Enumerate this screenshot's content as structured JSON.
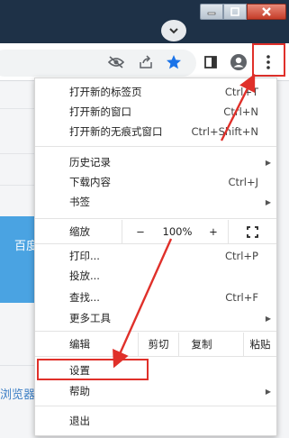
{
  "menu": {
    "new_tab": {
      "label": "打开新的标签页",
      "shortcut": "Ctrl+T"
    },
    "new_window": {
      "label": "打开新的窗口",
      "shortcut": "Ctrl+N"
    },
    "incognito": {
      "label": "打开新的无痕式窗口",
      "shortcut": "Ctrl+Shift+N"
    },
    "history": {
      "label": "历史记录"
    },
    "downloads": {
      "label": "下载内容",
      "shortcut": "Ctrl+J"
    },
    "bookmarks": {
      "label": "书签"
    },
    "zoom": {
      "label": "缩放",
      "minus": "−",
      "value": "100%",
      "plus": "+"
    },
    "print": {
      "label": "打印...",
      "shortcut": "Ctrl+P"
    },
    "cast": {
      "label": "投放..."
    },
    "find": {
      "label": "查找...",
      "shortcut": "Ctrl+F"
    },
    "more_tools": {
      "label": "更多工具"
    },
    "edit": {
      "label": "编辑",
      "cut": "剪切",
      "copy": "复制",
      "paste": "粘贴"
    },
    "settings": {
      "label": "设置"
    },
    "help": {
      "label": "帮助"
    },
    "exit": {
      "label": "退出"
    }
  },
  "page": {
    "blue_text": "百度",
    "blue_text2": "浏览器"
  },
  "colors": {
    "title_bar": "#1e3147",
    "highlight_red": "#e0302a",
    "star_blue": "#1a73e8"
  },
  "icons": {
    "tab_search": "chevron-down-icon",
    "minimize": "minimize-icon",
    "maximize": "maximize-icon",
    "close": "close-icon",
    "eye_off": "eye-off-icon",
    "share": "share-icon",
    "star": "star-icon",
    "side_panel": "side-panel-icon",
    "profile": "profile-icon",
    "menu": "kebab-menu-icon"
  }
}
